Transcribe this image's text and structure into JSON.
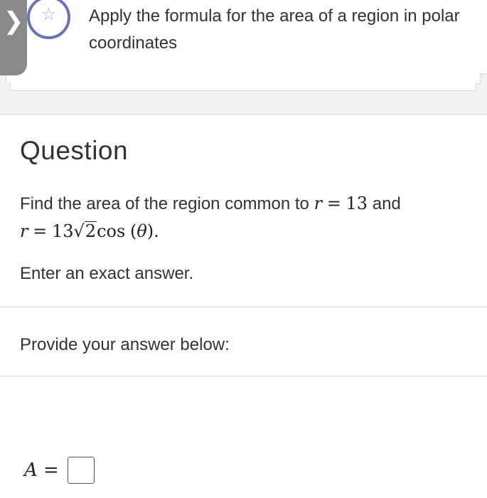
{
  "objective": {
    "collapse_glyph": "❯",
    "star_icon": "☆",
    "text": "Apply the formula for the area of a region in polar coordinates"
  },
  "question": {
    "heading": "Question",
    "prompt_prefix": "Find the area of the region common to",
    "eq1_var": "r",
    "eq1_equals": "=",
    "eq1_value": "13",
    "conjunction": "and",
    "eq2_var": "r",
    "eq2_equals": "=",
    "eq2_coef": "13",
    "eq2_radical_sign": "√",
    "eq2_radicand": "2",
    "eq2_func": "cos",
    "eq2_arg_open": "(",
    "eq2_arg": "θ",
    "eq2_arg_close": ").",
    "instruction": "Enter an exact answer."
  },
  "answer": {
    "provide_label": "Provide your answer below:",
    "variable": "A",
    "equals": "=",
    "value": ""
  },
  "colors": {
    "star_ring": "#6b73b8",
    "collapse_tab": "#8a8a8a",
    "text": "#333333"
  }
}
